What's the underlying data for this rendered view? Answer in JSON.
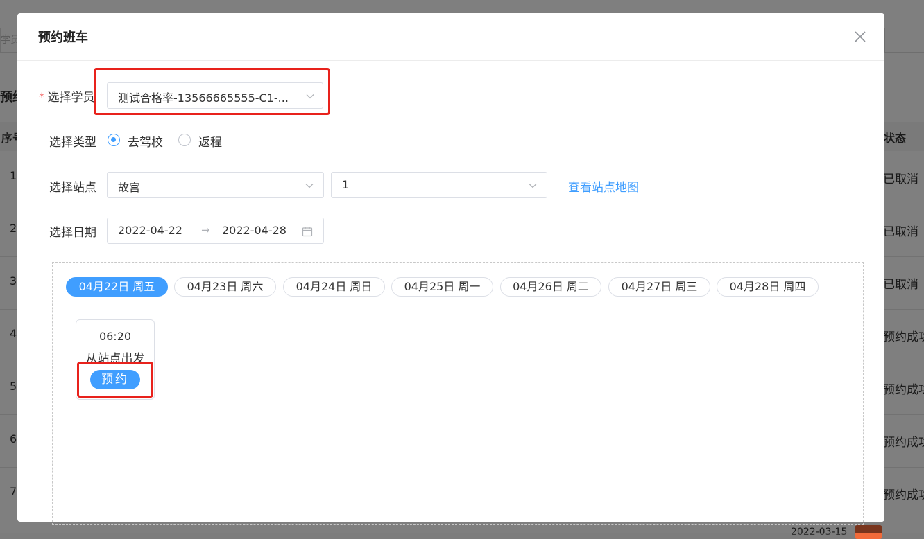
{
  "background": {
    "left_input_placeholder": "学员",
    "left_title": "预约",
    "header_left": "序号",
    "header_right": "状态",
    "rows": [
      {
        "seq": "1",
        "status": "已取消"
      },
      {
        "seq": "2",
        "status": "已取消"
      },
      {
        "seq": "3",
        "status": "已取消"
      },
      {
        "seq": "4",
        "status": "预约成功"
      },
      {
        "seq": "5",
        "status": "预约成功"
      },
      {
        "seq": "6",
        "status": "预约成功"
      },
      {
        "seq": "7",
        "status": "预约成功"
      }
    ],
    "bottom_text": "2022-03-15"
  },
  "modal": {
    "title": "预约班车",
    "close_icon": "close-icon"
  },
  "form": {
    "student": {
      "label": "选择学员",
      "required_mark": "*",
      "value": "测试合格率-13566665555-C1-..."
    },
    "type": {
      "label": "选择类型",
      "options": [
        {
          "label": "去驾校",
          "checked": true
        },
        {
          "label": "返程",
          "checked": false
        }
      ]
    },
    "station": {
      "label": "选择站点",
      "station_value": "故宫",
      "number_value": "1",
      "map_link": "查看站点地图"
    },
    "date": {
      "label": "选择日期",
      "start": "2022-04-22",
      "separator": "→",
      "end": "2022-04-28",
      "calendar_icon": "calendar-icon"
    }
  },
  "schedule": {
    "date_tabs": [
      {
        "label": "04月22日 周五",
        "active": true
      },
      {
        "label": "04月23日 周六",
        "active": false
      },
      {
        "label": "04月24日 周日",
        "active": false
      },
      {
        "label": "04月25日 周一",
        "active": false
      },
      {
        "label": "04月26日 周二",
        "active": false
      },
      {
        "label": "04月27日 周三",
        "active": false
      },
      {
        "label": "04月28日 周四",
        "active": false
      }
    ],
    "slots": [
      {
        "time": "06:20",
        "description": "从站点出发",
        "button": "预约"
      }
    ]
  },
  "colors": {
    "primary": "#409eff",
    "highlight": "#e8221c",
    "required": "#f56c6c"
  }
}
